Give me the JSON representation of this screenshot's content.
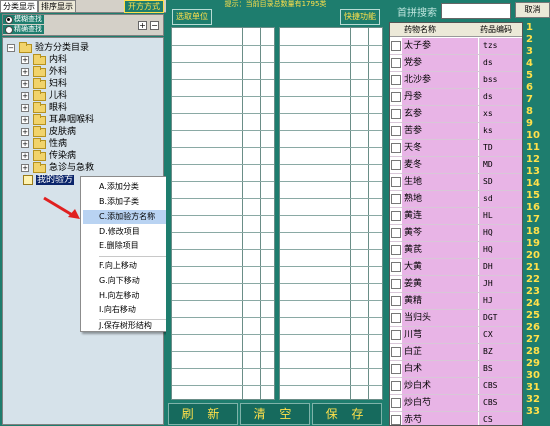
{
  "left": {
    "tabs": [
      "分类显示",
      "排序显示"
    ],
    "tab_right": "开方方式",
    "radios": [
      {
        "label": "模糊查找",
        "checked": true
      },
      {
        "label": "精确查找",
        "checked": false
      }
    ],
    "mini_buttons": [
      "+",
      "−"
    ],
    "tree": {
      "root": "验方分类目录",
      "children": [
        "内科",
        "外科",
        "妇科",
        "儿科",
        "眼科",
        "耳鼻咽喉科",
        "皮肤病",
        "性病",
        "传染病",
        "急诊与急救"
      ],
      "selected": "我的验方"
    }
  },
  "context_menu": {
    "items": [
      "A.添加分类",
      "B.添加子类",
      "C.添加验方名称",
      "D.修改项目",
      "E.删除项目",
      "F.向上移动",
      "G.向下移动",
      "H.向左移动",
      "I.向右移动",
      "J.保存树形结构"
    ],
    "highlighted_index": 2
  },
  "mid": {
    "notice": "提示：当前目录总数量有1795类",
    "btn_select": "选取单位",
    "btn_quick": "快捷功能",
    "bottom_buttons": [
      "刷 新",
      "清 空",
      "保 存"
    ]
  },
  "right": {
    "quick_search_label": "首拼搜索",
    "cancel_button": "取消",
    "headers": [
      "药物名称",
      "药品编码"
    ],
    "medicines": [
      {
        "name": "太子参",
        "code": "tzs"
      },
      {
        "name": "党参",
        "code": "ds"
      },
      {
        "name": "北沙参",
        "code": "bss"
      },
      {
        "name": "丹参",
        "code": "ds"
      },
      {
        "name": "玄参",
        "code": "xs"
      },
      {
        "name": "苦参",
        "code": "ks"
      },
      {
        "name": "天冬",
        "code": "TD"
      },
      {
        "name": "麦冬",
        "code": "MD"
      },
      {
        "name": "生地",
        "code": "SD"
      },
      {
        "name": "熟地",
        "code": "sd"
      },
      {
        "name": "黄连",
        "code": "HL"
      },
      {
        "name": "黄芩",
        "code": "HQ"
      },
      {
        "name": "黄芪",
        "code": "HQ"
      },
      {
        "name": "大黄",
        "code": "DH"
      },
      {
        "name": "姜黄",
        "code": "JH"
      },
      {
        "name": "黄精",
        "code": "HJ"
      },
      {
        "name": "当归头",
        "code": "DGT"
      },
      {
        "name": "川芎",
        "code": "CX"
      },
      {
        "name": "白芷",
        "code": "BZ"
      },
      {
        "name": "白术",
        "code": "BS"
      },
      {
        "name": "炒白术",
        "code": "CBS"
      },
      {
        "name": "炒白芍",
        "code": "CBS"
      },
      {
        "name": "赤芍",
        "code": "CS"
      },
      {
        "name": "白前",
        "code": "BQ"
      }
    ],
    "numbers": [
      "1",
      "2",
      "3",
      "4",
      "5",
      "6",
      "7",
      "8",
      "9",
      "10",
      "11",
      "12",
      "13",
      "14",
      "15",
      "16",
      "17",
      "18",
      "19",
      "20",
      "21",
      "22",
      "23",
      "24",
      "25",
      "26",
      "27",
      "28",
      "29",
      "30",
      "31",
      "32",
      "33"
    ]
  }
}
